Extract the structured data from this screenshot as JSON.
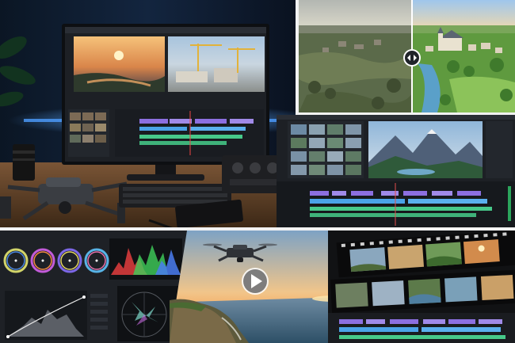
{
  "collage": {
    "panels": [
      {
        "subject": "desk-workstation-with-drone-and-editing-monitor"
      },
      {
        "subject": "aerial-village-before-after-comparison"
      },
      {
        "subject": "nle-timeline-mountain-lake-preview"
      },
      {
        "subject": "color-grading-wheels-scopes-curves"
      },
      {
        "subject": "drone-over-coastal-cliffs-sunset"
      },
      {
        "subject": "filmstrip-frames-and-timeline"
      }
    ],
    "colors": {
      "background": "#f2f2f2",
      "ui_dark": "#1d2025",
      "ui_panel": "#2a2e35",
      "accent_purple": "#8c6fe0",
      "accent_green": "#47c98a",
      "accent_blue": "#4aa3e8",
      "sunset": "#f2a65a",
      "desk_wood": "#6b4a2f",
      "led_blue": "#3f8cff"
    },
    "icons": [
      "comparison-slider-handle-icon",
      "play-button-icon",
      "drone-icon",
      "timeline-playhead-icon"
    ]
  }
}
